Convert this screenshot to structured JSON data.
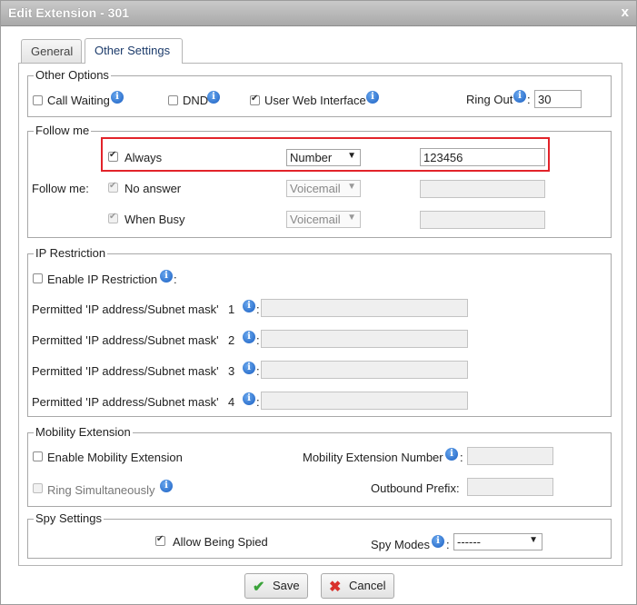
{
  "window": {
    "title": "Edit Extension - 301",
    "close_label": "x"
  },
  "tabs": [
    {
      "label": "General"
    },
    {
      "label": "Other Settings"
    }
  ],
  "other_options": {
    "legend": "Other Options",
    "call_waiting": {
      "label": "Call Waiting",
      "checked": false
    },
    "dnd": {
      "label": "DND",
      "checked": false
    },
    "user_web_interface": {
      "label": "User Web Interface",
      "checked": true
    },
    "ring_out": {
      "label": "Ring Out",
      "colon": ":",
      "value": "30"
    }
  },
  "follow_me": {
    "legend": "Follow me",
    "label": "Follow me:",
    "rows": [
      {
        "label": "Always",
        "checked": true,
        "enabled": true,
        "select": "Number",
        "value": "123456"
      },
      {
        "label": "No answer",
        "checked": true,
        "enabled": false,
        "select": "Voicemail",
        "value": ""
      },
      {
        "label": "When Busy",
        "checked": true,
        "enabled": false,
        "select": "Voicemail",
        "value": ""
      }
    ]
  },
  "ip_restriction": {
    "legend": "IP Restriction",
    "enable_label": "Enable IP Restriction",
    "colon": ":",
    "permitted": [
      {
        "label": "Permitted 'IP address/Subnet mask'",
        "num": "1"
      },
      {
        "label": "Permitted 'IP address/Subnet mask'",
        "num": "2"
      },
      {
        "label": "Permitted 'IP address/Subnet mask'",
        "num": "3"
      },
      {
        "label": "Permitted 'IP address/Subnet mask'",
        "num": "4"
      }
    ]
  },
  "mobility": {
    "legend": "Mobility Extension",
    "enable_label": "Enable Mobility Extension",
    "ring_label": "Ring Simultaneously",
    "number_label": "Mobility Extension Number",
    "prefix_label": "Outbound Prefix:",
    "colon": ":"
  },
  "spy": {
    "legend": "Spy Settings",
    "allow_label": "Allow Being Spied",
    "modes_label": "Spy Modes",
    "colon": ":",
    "modes_value": "------"
  },
  "buttons": {
    "save": "Save",
    "cancel": "Cancel"
  },
  "icons": {
    "info": "i",
    "arrow": "▼",
    "save": "✔",
    "cancel": "✖"
  },
  "colors": {
    "highlight": "#e2232a",
    "info": "#1a5fc2",
    "save_icon": "#3aa33a",
    "cancel_icon": "#d9302b"
  }
}
